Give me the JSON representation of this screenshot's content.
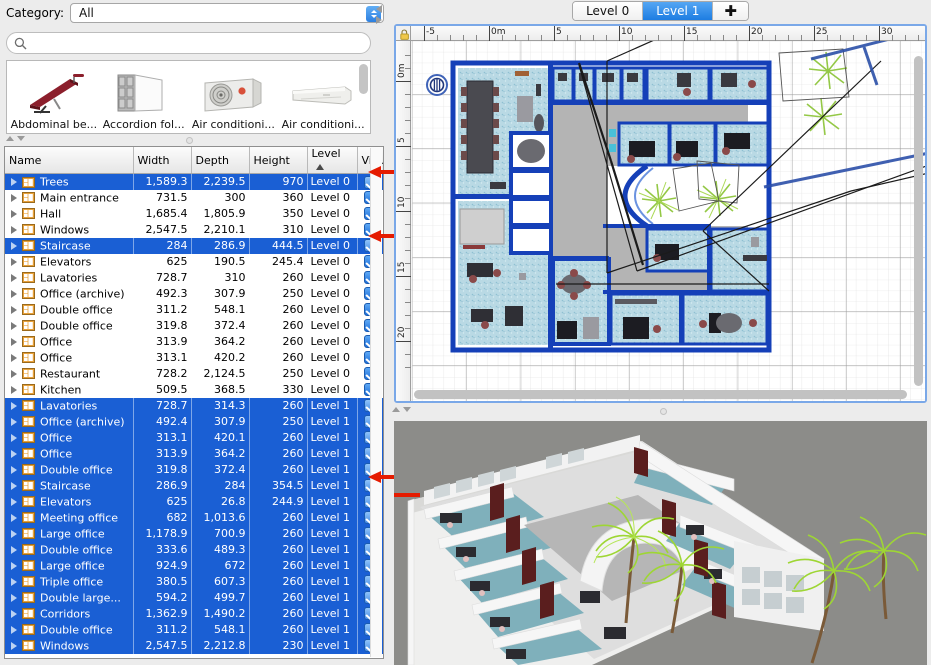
{
  "catalog": {
    "category_label": "Category:",
    "category_value": "All",
    "search_placeholder": "",
    "search_value": "",
    "items": [
      {
        "name": "Abdominal be...",
        "icon": "abdominal-bench-thumb"
      },
      {
        "name": "Accordion fol...",
        "icon": "accordion-folding-door-thumb"
      },
      {
        "name": "Air conditioni...",
        "icon": "air-conditioning-unit-thumb"
      },
      {
        "name": "Air conditioni...",
        "icon": "air-conditioning-split-thumb"
      }
    ]
  },
  "furniture_table": {
    "columns": [
      "Name",
      "Width",
      "Depth",
      "Height",
      "Level",
      "Vis..."
    ],
    "sort_column": "Level",
    "sort_direction": "ascending",
    "rows": [
      {
        "name": "Trees",
        "width": "1,589.3",
        "depth": "2,239.5",
        "height": "970",
        "level": "Level 0",
        "visible": true,
        "selected": true
      },
      {
        "name": "Main entrance",
        "width": "731.5",
        "depth": "300",
        "height": "360",
        "level": "Level 0",
        "visible": true,
        "selected": false
      },
      {
        "name": "Hall",
        "width": "1,685.4",
        "depth": "1,805.9",
        "height": "350",
        "level": "Level 0",
        "visible": true,
        "selected": false
      },
      {
        "name": "Windows",
        "width": "2,547.5",
        "depth": "2,210.1",
        "height": "310",
        "level": "Level 0",
        "visible": true,
        "selected": false
      },
      {
        "name": "Staircase",
        "width": "284",
        "depth": "286.9",
        "height": "444.5",
        "level": "Level 0",
        "visible": true,
        "selected": true
      },
      {
        "name": "Elevators",
        "width": "625",
        "depth": "190.5",
        "height": "245.4",
        "level": "Level 0",
        "visible": true,
        "selected": false
      },
      {
        "name": "Lavatories",
        "width": "728.7",
        "depth": "310",
        "height": "260",
        "level": "Level 0",
        "visible": true,
        "selected": false
      },
      {
        "name": "Office (archive)",
        "width": "492.3",
        "depth": "307.9",
        "height": "250",
        "level": "Level 0",
        "visible": true,
        "selected": false
      },
      {
        "name": "Double office",
        "width": "311.2",
        "depth": "548.1",
        "height": "260",
        "level": "Level 0",
        "visible": true,
        "selected": false
      },
      {
        "name": "Double office",
        "width": "319.8",
        "depth": "372.4",
        "height": "260",
        "level": "Level 0",
        "visible": true,
        "selected": false
      },
      {
        "name": "Office",
        "width": "313.9",
        "depth": "364.2",
        "height": "260",
        "level": "Level 0",
        "visible": true,
        "selected": false
      },
      {
        "name": "Office",
        "width": "313.1",
        "depth": "420.2",
        "height": "260",
        "level": "Level 0",
        "visible": true,
        "selected": false
      },
      {
        "name": "Restaurant",
        "width": "728.2",
        "depth": "2,124.5",
        "height": "250",
        "level": "Level 0",
        "visible": true,
        "selected": false
      },
      {
        "name": "Kitchen",
        "width": "509.5",
        "depth": "368.5",
        "height": "330",
        "level": "Level 0",
        "visible": true,
        "selected": false
      },
      {
        "name": "Lavatories",
        "width": "728.7",
        "depth": "314.3",
        "height": "260",
        "level": "Level 1",
        "visible": true,
        "selected": true
      },
      {
        "name": "Office (archive)",
        "width": "492.4",
        "depth": "307.9",
        "height": "250",
        "level": "Level 1",
        "visible": true,
        "selected": true
      },
      {
        "name": "Office",
        "width": "313.1",
        "depth": "420.1",
        "height": "260",
        "level": "Level 1",
        "visible": true,
        "selected": true
      },
      {
        "name": "Office",
        "width": "313.9",
        "depth": "364.2",
        "height": "260",
        "level": "Level 1",
        "visible": true,
        "selected": true
      },
      {
        "name": "Double office",
        "width": "319.8",
        "depth": "372.4",
        "height": "260",
        "level": "Level 1",
        "visible": true,
        "selected": true
      },
      {
        "name": "Staircase",
        "width": "286.9",
        "depth": "284",
        "height": "354.5",
        "level": "Level 1",
        "visible": true,
        "selected": true
      },
      {
        "name": "Elevators",
        "width": "625",
        "depth": "26.8",
        "height": "244.9",
        "level": "Level 1",
        "visible": true,
        "selected": true
      },
      {
        "name": "Meeting office",
        "width": "682",
        "depth": "1,013.6",
        "height": "260",
        "level": "Level 1",
        "visible": true,
        "selected": true
      },
      {
        "name": "Large office",
        "width": "1,178.9",
        "depth": "700.9",
        "height": "260",
        "level": "Level 1",
        "visible": true,
        "selected": true
      },
      {
        "name": "Double office",
        "width": "333.6",
        "depth": "489.3",
        "height": "260",
        "level": "Level 1",
        "visible": true,
        "selected": true
      },
      {
        "name": "Large office",
        "width": "924.9",
        "depth": "672",
        "height": "260",
        "level": "Level 1",
        "visible": true,
        "selected": true
      },
      {
        "name": "Triple office",
        "width": "380.5",
        "depth": "607.3",
        "height": "260",
        "level": "Level 1",
        "visible": true,
        "selected": true
      },
      {
        "name": "Double large...",
        "width": "594.2",
        "depth": "499.7",
        "height": "260",
        "level": "Level 1",
        "visible": true,
        "selected": true
      },
      {
        "name": "Corridors",
        "width": "1,362.9",
        "depth": "1,490.2",
        "height": "260",
        "level": "Level 1",
        "visible": true,
        "selected": true
      },
      {
        "name": "Double office",
        "width": "311.2",
        "depth": "548.1",
        "height": "260",
        "level": "Level 1",
        "visible": true,
        "selected": true
      },
      {
        "name": "Windows",
        "width": "2,547.5",
        "depth": "2,212.8",
        "height": "230",
        "level": "Level 1",
        "visible": true,
        "selected": true
      }
    ]
  },
  "level_tabs": {
    "tabs": [
      {
        "label": "Level 0",
        "active": false
      },
      {
        "label": "Level 1",
        "active": true
      }
    ],
    "add_label": "✚"
  },
  "plan": {
    "unit_origin_label": "0m",
    "h_ruler_labels": [
      "-5",
      "0m",
      "5",
      "10",
      "15",
      "20",
      "25",
      "30"
    ],
    "v_ruler_labels": [
      "0m",
      "5",
      "10",
      "15",
      "20"
    ],
    "compass_icon": "compass-icon",
    "lock_icon": "lock-icon"
  },
  "colors": {
    "selection_blue": "#1a5fd4",
    "tab_active_blue": "#1d7de2",
    "arrow_red": "#e51b00",
    "wall_blue": "#1540b8",
    "room_fill": "#b9d9e4",
    "view3d_bg": "#8c8c89"
  },
  "annotations": [
    {
      "name": "arrow-trees-row"
    },
    {
      "name": "arrow-staircase-level0-row"
    },
    {
      "name": "arrow-staircase-level1-row"
    }
  ]
}
